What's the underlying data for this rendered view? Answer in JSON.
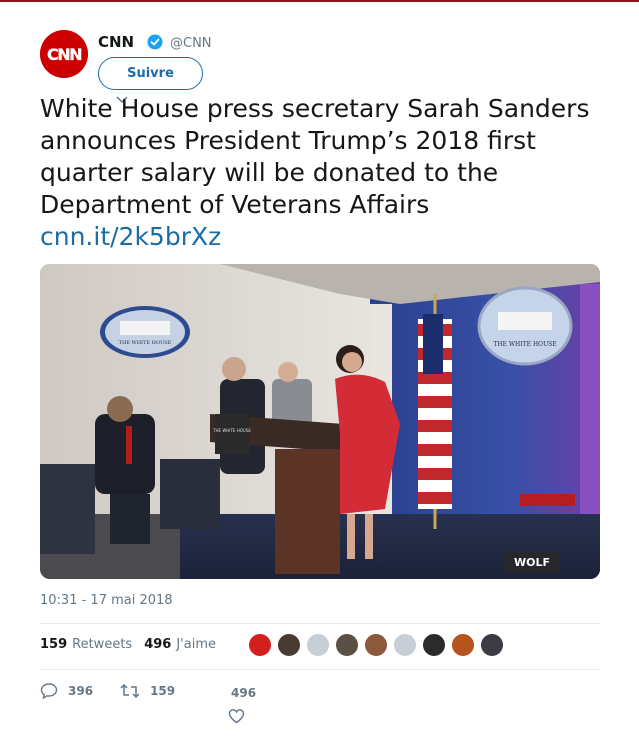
{
  "author": {
    "name": "CNN",
    "handle": "@CNN",
    "avatar_text": "CNN",
    "verified_icon": "verified-badge-icon"
  },
  "follow_button": {
    "label": "Suivre"
  },
  "tweet": {
    "text": "White House press secretary Sarah Sanders announces President Trump’s 2018 first quarter salary will be donated to the Department of Veterans Affairs",
    "link": "cnn.it/2k5brXz"
  },
  "media": {
    "overlay_tag": "WOLF",
    "seal_text_left": "THE WHITE HOUSE",
    "seal_text_right": "THE WHITE HOUSE",
    "podium_sign": "THE WHITE HOUSE"
  },
  "timestamp": "10:31 - 17 mai 2018",
  "stats": {
    "retweets_count": "159",
    "retweets_label": "Retweets",
    "likes_count": "496",
    "likes_label": "J'aime"
  },
  "likers": [
    {
      "name": "liker-avatar-1",
      "color": "#d41f1f"
    },
    {
      "name": "liker-avatar-2",
      "color": "#4a3b32"
    },
    {
      "name": "liker-avatar-3",
      "color": "#c8ced6"
    },
    {
      "name": "liker-avatar-4",
      "color": "#5a5046"
    },
    {
      "name": "liker-avatar-5",
      "color": "#8b5a3c"
    },
    {
      "name": "liker-avatar-6",
      "color": "#c8ced6"
    },
    {
      "name": "liker-avatar-7",
      "color": "#2b2b2b"
    },
    {
      "name": "liker-avatar-8",
      "color": "#b5541c"
    },
    {
      "name": "liker-avatar-9",
      "color": "#3c3c44"
    }
  ],
  "actions": {
    "replies": "396",
    "retweets": "159",
    "likes": "496"
  },
  "colors": {
    "accent": "#1b6ca8",
    "muted": "#657786",
    "brand_red": "#cc0000"
  }
}
